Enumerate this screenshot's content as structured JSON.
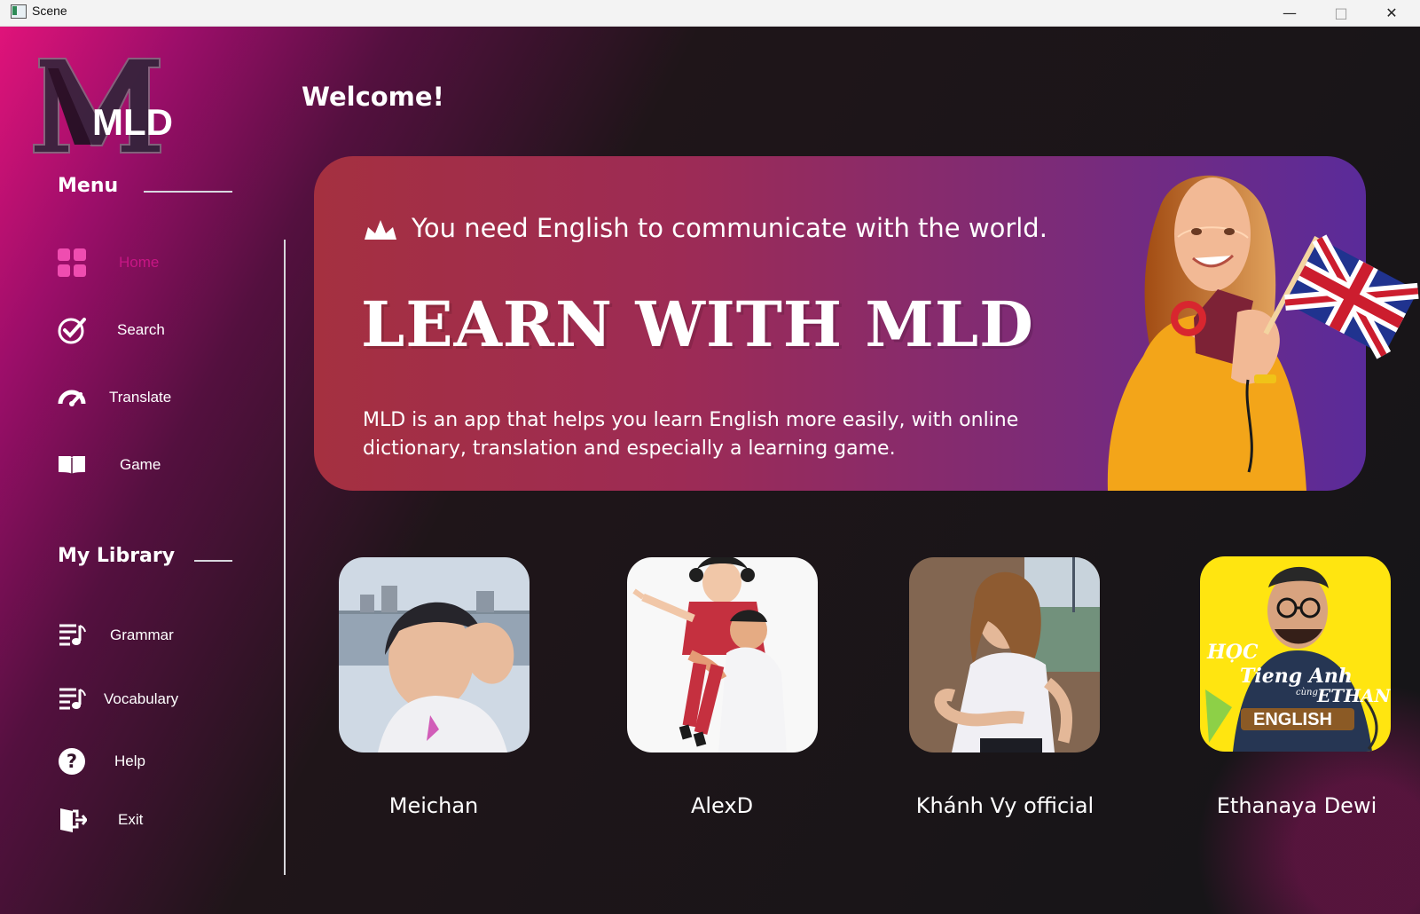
{
  "window": {
    "title": "Scene",
    "minimize": "—",
    "maximize": "□",
    "close": "✕"
  },
  "sidebar": {
    "logo_text": "MLD",
    "menu_heading": "Menu",
    "menu": [
      {
        "label": "Home",
        "icon": "dashboard-grid-icon",
        "active": true
      },
      {
        "label": "Search",
        "icon": "check-circle-icon"
      },
      {
        "label": "Translate",
        "icon": "speedometer-icon"
      },
      {
        "label": "Game",
        "icon": "book-icon"
      }
    ],
    "library_heading": "My Library",
    "library": [
      {
        "label": "Grammar",
        "icon": "music-list-icon"
      },
      {
        "label": "Vocabulary",
        "icon": "music-list-icon"
      },
      {
        "label": "Help",
        "icon": "question-circle-icon"
      },
      {
        "label": "Exit",
        "icon": "exit-door-icon"
      }
    ]
  },
  "main": {
    "welcome": "Welcome!",
    "hero": {
      "tagline": "You need English to communicate with the world.",
      "headline": "LEARN WITH MLD",
      "description": "MLD is an app that helps you learn English more easily, with online dictionary, translation and especially a learning game."
    },
    "creators": [
      {
        "name": "Meichan"
      },
      {
        "name": "AlexD"
      },
      {
        "name": "Khánh Vy official"
      },
      {
        "name": "Ethanaya Dewi"
      }
    ]
  },
  "colors": {
    "accent": "#c71685",
    "hero_left": "#a53040",
    "hero_right": "#5a2b9a",
    "background": "#151518"
  }
}
